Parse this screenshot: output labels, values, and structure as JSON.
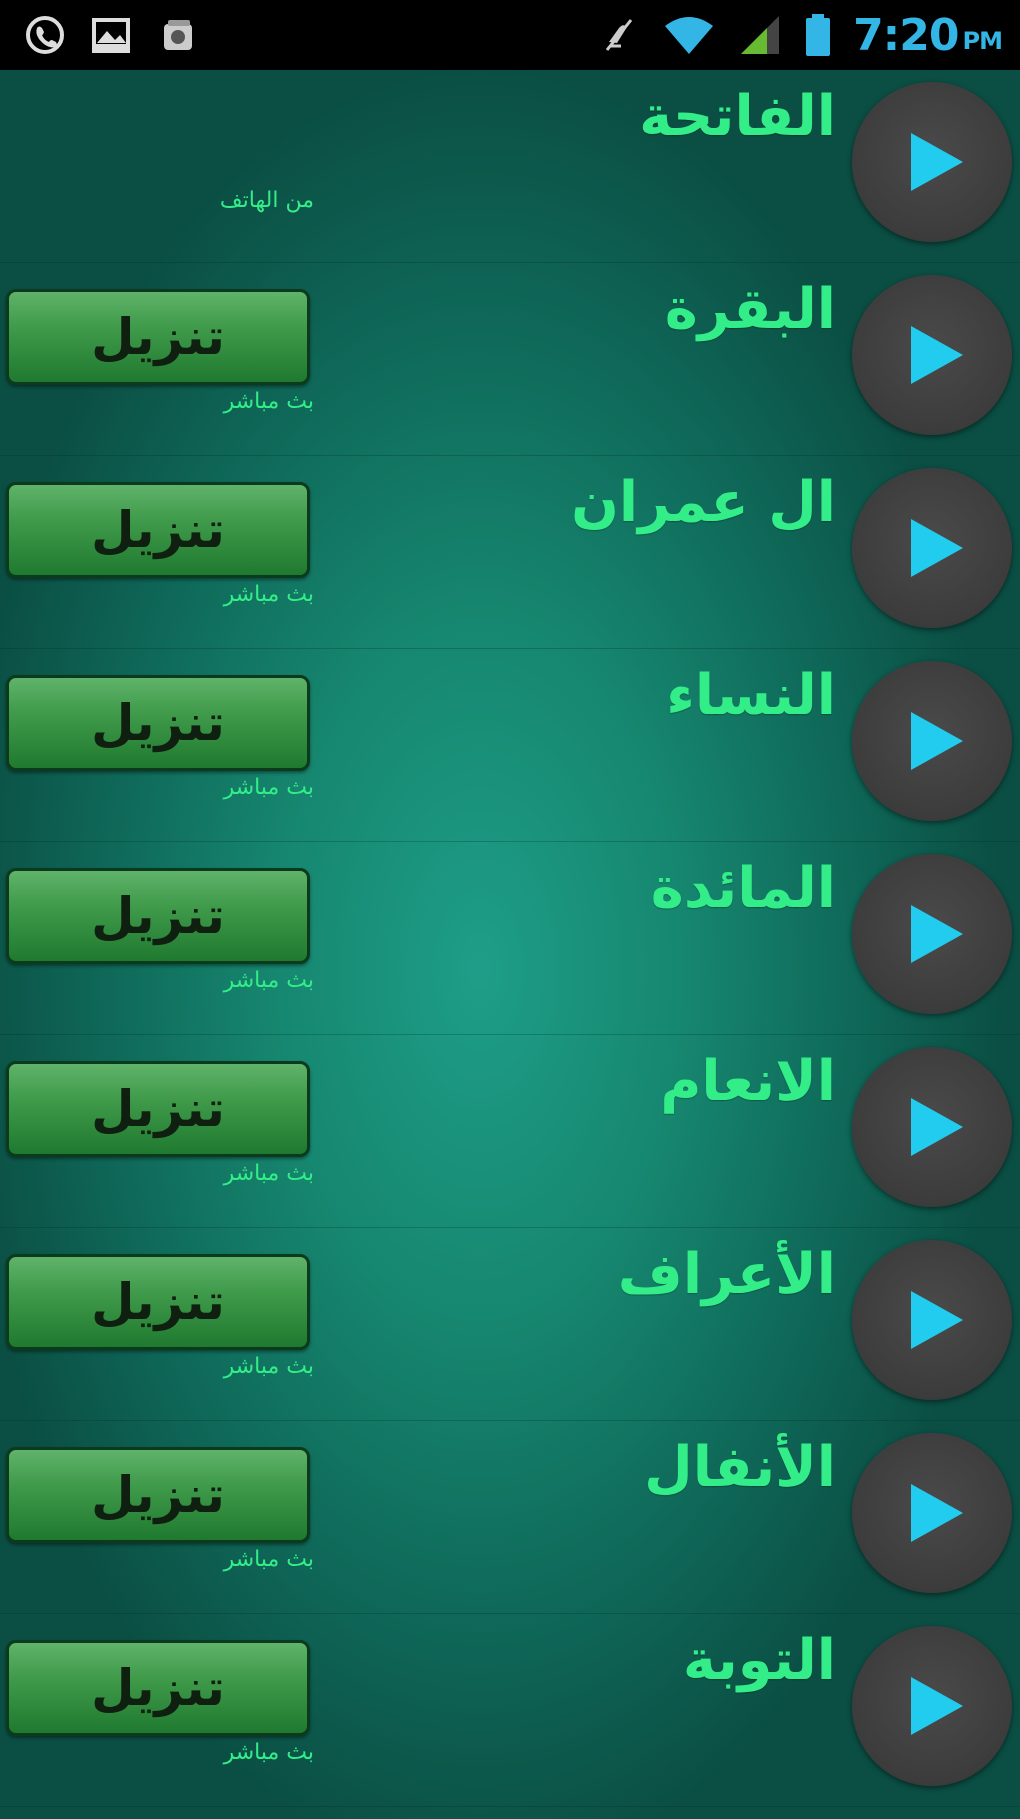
{
  "status_bar": {
    "left_icons": [
      "viber-icon",
      "image-icon",
      "media-icon"
    ],
    "right_icons": [
      "mute-icon",
      "wifi-icon",
      "signal-icon",
      "battery-icon"
    ],
    "time": "7:20",
    "ampm": "PM",
    "accent": "#33b5e5"
  },
  "colors": {
    "name_text": "#33ee88",
    "play_triangle": "#22ccee",
    "download_green": "#2e8a3c"
  },
  "surahs": [
    {
      "name": "الفاتحة",
      "status": "من الهاتف",
      "download_label": ""
    },
    {
      "name": "البقرة",
      "status": "بث مباشر",
      "download_label": "تنزيل"
    },
    {
      "name": "ال عمران",
      "status": "بث مباشر",
      "download_label": "تنزيل"
    },
    {
      "name": "النساء",
      "status": "بث مباشر",
      "download_label": "تنزيل"
    },
    {
      "name": "المائدة",
      "status": "بث مباشر",
      "download_label": "تنزيل"
    },
    {
      "name": "الانعام",
      "status": "بث مباشر",
      "download_label": "تنزيل"
    },
    {
      "name": "الأعراف",
      "status": "بث مباشر",
      "download_label": "تنزيل"
    },
    {
      "name": "الأنفال",
      "status": "بث مباشر",
      "download_label": "تنزيل"
    },
    {
      "name": "التوبة",
      "status": "بث مباشر",
      "download_label": "تنزيل"
    }
  ]
}
